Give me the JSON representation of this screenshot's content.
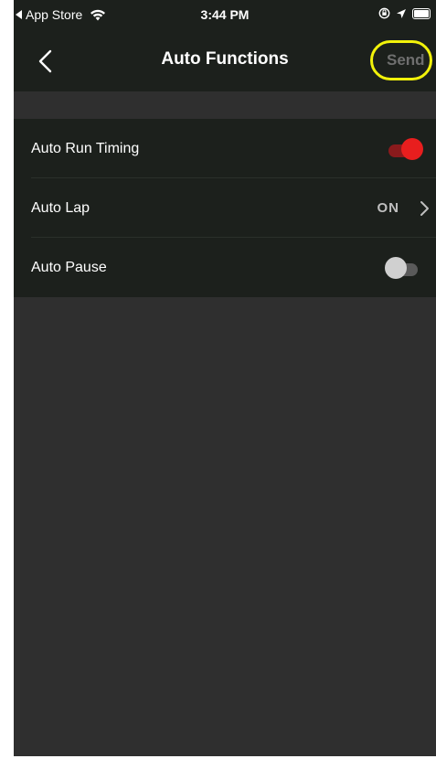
{
  "status_bar": {
    "back_app_label": "App Store",
    "time": "3:44 PM",
    "icons": [
      "wifi-icon",
      "orientation-lock-icon",
      "location-icon",
      "battery-icon"
    ]
  },
  "nav": {
    "title": "Auto Functions",
    "send_label": "Send",
    "back_icon": "chevron-left-icon"
  },
  "colors": {
    "bar_background": "#1c201c",
    "page_background": "#2f2f2f",
    "toggle_on": "#e81e1e",
    "highlight_ring": "#f2f20a",
    "send_disabled": "#6f6f6f"
  },
  "settings": [
    {
      "label": "Auto Run Timing",
      "type": "toggle",
      "state": "on"
    },
    {
      "label": "Auto Lap",
      "type": "value",
      "value": "ON"
    },
    {
      "label": "Auto Pause",
      "type": "toggle",
      "state": "off"
    }
  ]
}
